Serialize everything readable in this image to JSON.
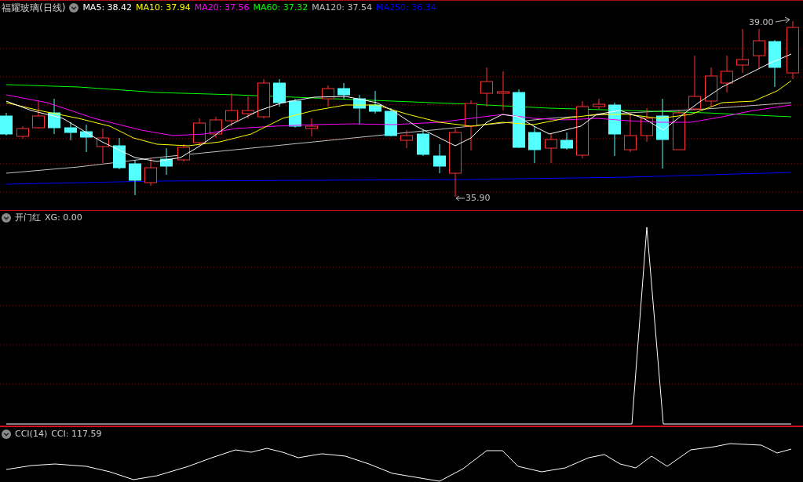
{
  "main_panel": {
    "title": "福耀玻璃(日线)",
    "indicators": [
      {
        "label": "MA5: 38.42",
        "color": "#ffffff"
      },
      {
        "label": "MA10: 37.94",
        "color": "#ffff00"
      },
      {
        "label": "MA20: 37.56",
        "color": "#ff00ff"
      },
      {
        "label": "MA60: 37.32",
        "color": "#00ff00"
      },
      {
        "label": "MA120: 37.54",
        "color": "#c0c0c0"
      },
      {
        "label": "MA250: 36.34",
        "color": "#0000ff"
      }
    ],
    "high_label": "39.00",
    "low_label": "35.90"
  },
  "indicator_panels": [
    {
      "kind": "signal",
      "name": "开门红",
      "reading": "XG: 0.00"
    },
    {
      "kind": "oscillator",
      "name": "CCI(14)",
      "reading": "CCI: 117.59"
    }
  ]
}
